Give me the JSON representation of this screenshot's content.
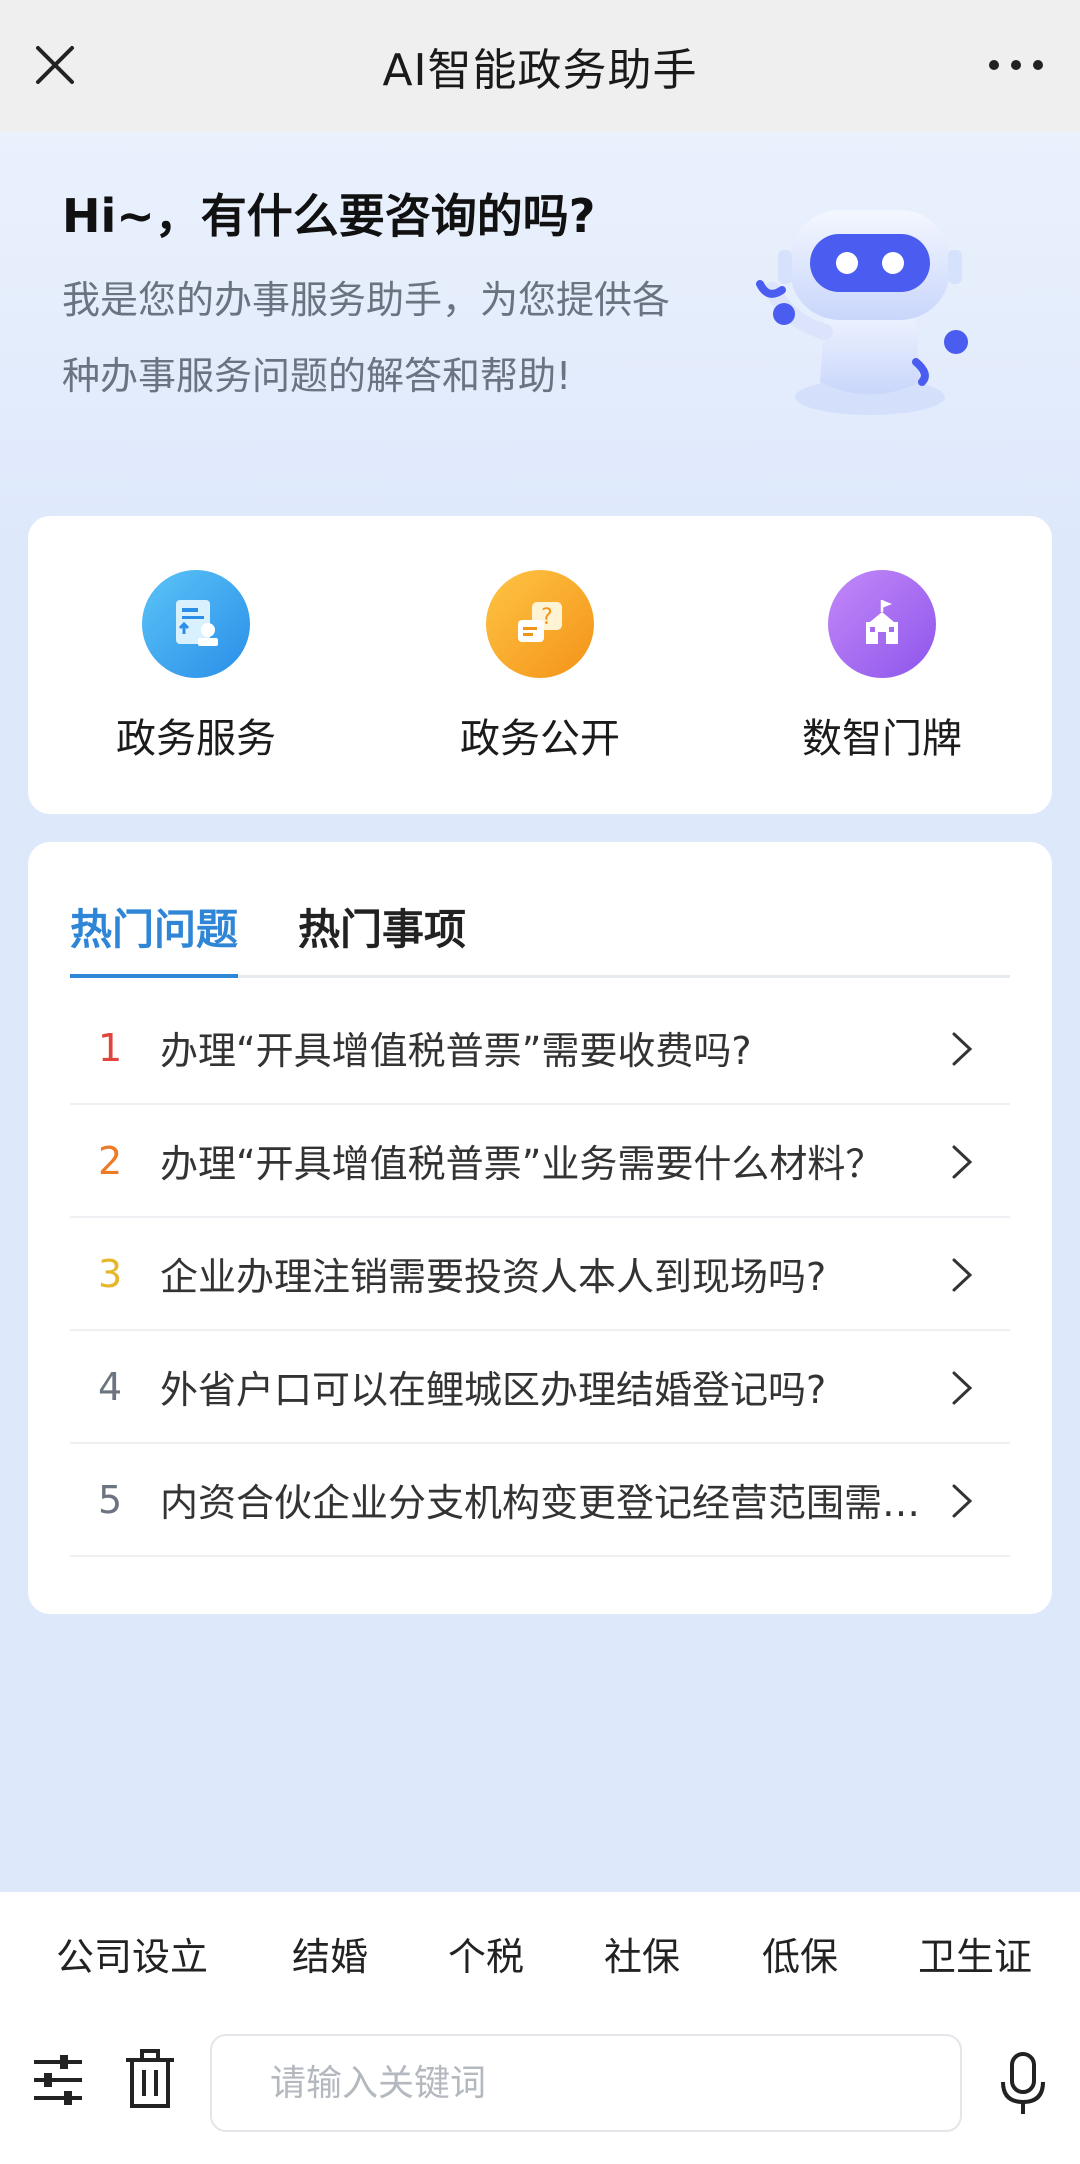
{
  "header": {
    "title": "AI智能政务助手",
    "close_icon": "close-icon",
    "more_icon": "more-icon"
  },
  "hero": {
    "greeting": "Hi~，有什么要咨询的吗?",
    "description": "我是您的办事服务助手，为您提供各种办事服务问题的解答和帮助!",
    "mascot_icon": "robot-mascot-icon"
  },
  "services": [
    {
      "label": "政务服务",
      "icon": "document-service-icon",
      "color": "#3aa6f0"
    },
    {
      "label": "政务公开",
      "icon": "question-chat-icon",
      "color": "#f7a21f"
    },
    {
      "label": "数智门牌",
      "icon": "building-flag-icon",
      "color": "#a46cf0"
    }
  ],
  "tabs": [
    {
      "label": "热门问题",
      "active": true
    },
    {
      "label": "热门事项",
      "active": false
    }
  ],
  "questions": [
    {
      "num": "1",
      "text": "办理“开具增值税普票”需要收费吗?",
      "color": "#e0453d"
    },
    {
      "num": "2",
      "text": "办理“开具增值税普票”业务需要什么材料？",
      "color": "#ee7a25"
    },
    {
      "num": "3",
      "text": "企业办理注销需要投资人本人到现场吗?",
      "color": "#e7b72b"
    },
    {
      "num": "4",
      "text": "外省户口可以在鲤城区办理结婚登记吗?",
      "color": "#6b7480"
    },
    {
      "num": "5",
      "text": "内资合伙企业分支机构变更登记经营范围需要什么材料？",
      "color": "#6b7480"
    }
  ],
  "quick_chips": [
    "公司设立",
    "结婚",
    "个税",
    "社保",
    "低保",
    "卫生证"
  ],
  "input": {
    "placeholder": "请输入关键词",
    "filter_icon": "filter-sliders-icon",
    "trash_icon": "trash-icon",
    "mic_icon": "microphone-icon"
  },
  "colors": {
    "accent": "#2f86d6",
    "background": "#dde9fb",
    "mascot": "#4a5df0"
  }
}
